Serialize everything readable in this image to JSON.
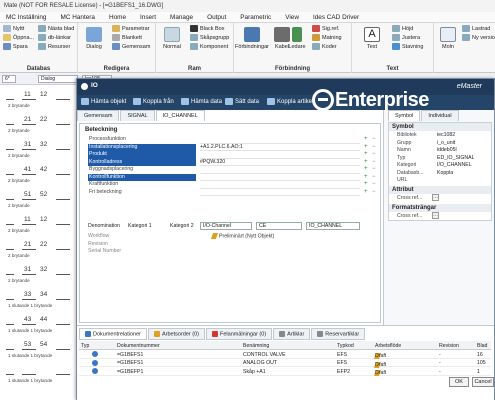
{
  "cad": {
    "title": "Mate (NOT FOR RESALE License) - [=G1BEFS1_16.DWG]",
    "menu": [
      "MC Inställning",
      "MC Hantera",
      "Home",
      "Insert",
      "Manage",
      "Output",
      "Parametric",
      "View",
      "Ides CAD Driver"
    ],
    "ribbon": {
      "groups": [
        {
          "label": "Databas",
          "buttons": [
            "Nyttt",
            "Öppna...",
            "Spara",
            "Nästa blad",
            "db-länkar",
            "Resurser"
          ]
        },
        {
          "label": "Redigera",
          "buttons": [
            "Dialog",
            "Parametrar",
            "Blankett",
            "Gemensam"
          ]
        },
        {
          "label": "Ram",
          "buttons": [
            "Normal",
            "Black Box",
            "Skåpsgrupp",
            "Komponent"
          ]
        },
        {
          "label": "Förbindning",
          "buttons": [
            "Förbindningar",
            "Kabel",
            "Ledare",
            "Sig.ref.",
            "Matning",
            "Koder"
          ]
        },
        {
          "label": "Text",
          "buttons": [
            "Text",
            "Höjd",
            "Justera",
            "Stavning"
          ]
        },
        {
          "label": "",
          "buttons": [
            "Moln",
            "Lastrad",
            "Ny versio"
          ]
        }
      ]
    },
    "layer_combo": "Dialog",
    "coord_combo": "lec108",
    "tab_label": "6*"
  },
  "terminals": [
    {
      "top": "11",
      "bottom": "12",
      "label": "2 brytande"
    },
    {
      "top": "21",
      "bottom": "22",
      "label": "2 brytande"
    },
    {
      "top": "31",
      "bottom": "32",
      "label": "2 brytande"
    },
    {
      "top": "41",
      "bottom": "42",
      "label": "2 brytande"
    },
    {
      "top": "51",
      "bottom": "52",
      "label": "2 brytande"
    },
    {
      "top": "11",
      "bottom": "12",
      "label": "2 brytande"
    },
    {
      "top": "21",
      "bottom": "22",
      "label": "2 brytande"
    },
    {
      "top": "31",
      "bottom": "32",
      "label": "2 brytande"
    },
    {
      "top": "33",
      "bottom": "34",
      "label": "1 slutande 1 brytande"
    },
    {
      "top": "43",
      "bottom": "44",
      "label": "1 slutande 1 brytande"
    },
    {
      "top": "53",
      "bottom": "54",
      "label": "1 slutande 1 brytande"
    },
    {
      "top": "",
      "bottom": "",
      "label": "1 slutande 1 brytande"
    }
  ],
  "dialog": {
    "title": "IO",
    "brand_small": "eMaster",
    "brand_big": "Enterprise",
    "toolbar": [
      "Hämta objekt",
      "Koppla från",
      "Hämta data",
      "Sätt data",
      "Koppla artikel"
    ],
    "tabs": [
      "Gemensam",
      "SIGNAL",
      "IO_CHANNEL"
    ],
    "section_title": "Beteckning",
    "properties": [
      {
        "label": "Processfunktion",
        "value": "",
        "sel": false
      },
      {
        "label": "Installationsplacering",
        "value": "+A1.2.PLC.6.AO:1",
        "sel": true
      },
      {
        "label": "Produkt",
        "value": "",
        "sel": true
      },
      {
        "label": "Kontrolladress",
        "value": "#PQW.320",
        "sel": true
      },
      {
        "label": "Byggnadsplacering",
        "value": "",
        "sel": false
      },
      {
        "label": "Kontrollfunktion",
        "value": "",
        "sel": true
      },
      {
        "label": "Kraftfunktion",
        "value": "",
        "sel": false
      },
      {
        "label": "Fri beteckning",
        "value": "",
        "sel": false
      }
    ],
    "denomination": {
      "label": "Denomination",
      "cat1_label": "Kategori 1",
      "cat2_label": "Kategori 2",
      "cat1_value": "I/O-Channel",
      "cat2_value": "CE",
      "cat3_value": "IO_CHANNEL"
    },
    "small_rows": [
      "Workflow",
      "Revision",
      "Serial Number"
    ],
    "workflow_value": "Preliminärt (Nytt Objekt)",
    "right": {
      "tabs": [
        "Symbol",
        "Individual"
      ],
      "symbol_head": "Symbol",
      "symbol_rows": [
        {
          "k": "Bibliotek",
          "v": "iec1082"
        },
        {
          "k": "Grupp",
          "v": "i_o_unit"
        },
        {
          "k": "Namn",
          "v": "iddeb05l"
        },
        {
          "k": "Typ",
          "v": "ED_IO_SIGNAL"
        },
        {
          "k": "Kategori",
          "v": "I/O_CHANNEL"
        },
        {
          "k": "Databasb...",
          "v": "Koppla"
        },
        {
          "k": "URL",
          "v": ""
        }
      ],
      "attr_head": "Attribut",
      "attr_row": "Cross ref...",
      "format_head": "Formatsträngar",
      "format_row": "Cross ref..."
    },
    "bottom_tabs": [
      {
        "label": "Dokumentrelationer",
        "color": "#3a76c4"
      },
      {
        "label": "Arbetsorder (0)",
        "color": "#e0a020"
      },
      {
        "label": "Felanmälningar (0)",
        "color": "#d03a2a"
      },
      {
        "label": "Artiklar",
        "color": "#888888"
      },
      {
        "label": "Reservartiklar",
        "color": "#888888"
      }
    ],
    "grid_head": [
      "Typ",
      "Dokumentnummer",
      "Benämning",
      "Typkod",
      "Arbetsflöde",
      "Revision",
      "Blad"
    ],
    "grid_rows": [
      {
        "doc": "=G1BEFS1",
        "name": "CONTROL VALVE",
        "type": "EFS",
        "flow": "Draft",
        "rev": "-",
        "sheet": "16"
      },
      {
        "doc": "=G1BEFS1",
        "name": "ANALOG OUT",
        "type": "EFS",
        "flow": "Draft",
        "rev": "-",
        "sheet": "105"
      },
      {
        "doc": "=G1BEFP1",
        "name": "Skåp +A1",
        "type": "EFP2",
        "flow": "Draft",
        "rev": "-",
        "sheet": "1"
      }
    ],
    "ok_label": "OK",
    "cancel_label": "Cancel"
  },
  "colors": {
    "dialog_title": "#1f3a5a",
    "selection": "#1e5aa8",
    "accent": "#3a76c4"
  }
}
